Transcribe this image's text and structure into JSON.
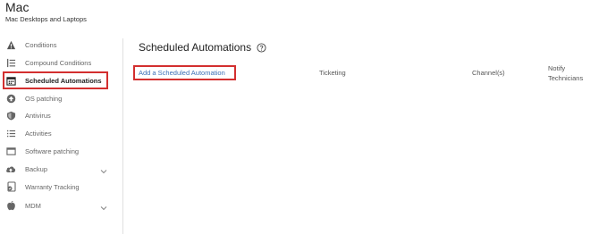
{
  "header": {
    "title": "Mac",
    "subtitle": "Mac Desktops and Laptops"
  },
  "sidebar": {
    "items": [
      {
        "label": "Conditions",
        "icon": "warning-icon"
      },
      {
        "label": "Compound Conditions",
        "icon": "list-tree-icon"
      },
      {
        "label": "Scheduled Automations",
        "icon": "calendar-icon",
        "active": true
      },
      {
        "label": "OS patching",
        "icon": "upload-circle-icon"
      },
      {
        "label": "Antivirus",
        "icon": "shield-icon"
      },
      {
        "label": "Activities",
        "icon": "list-icon"
      },
      {
        "label": "Software patching",
        "icon": "window-icon"
      },
      {
        "label": "Backup",
        "icon": "cloud-upload-icon",
        "expandable": true
      },
      {
        "label": "Warranty Tracking",
        "icon": "warranty-icon"
      },
      {
        "label": "MDM",
        "icon": "apple-icon",
        "expandable": true
      }
    ]
  },
  "main": {
    "title": "Scheduled Automations",
    "add_link": "Add a Scheduled Automation",
    "columns": {
      "ticketing": "Ticketing",
      "channels": "Channel(s)",
      "notify": "Notify Technicians"
    }
  },
  "colors": {
    "accent_red": "#d32f2f",
    "link": "#3b6fb6"
  }
}
